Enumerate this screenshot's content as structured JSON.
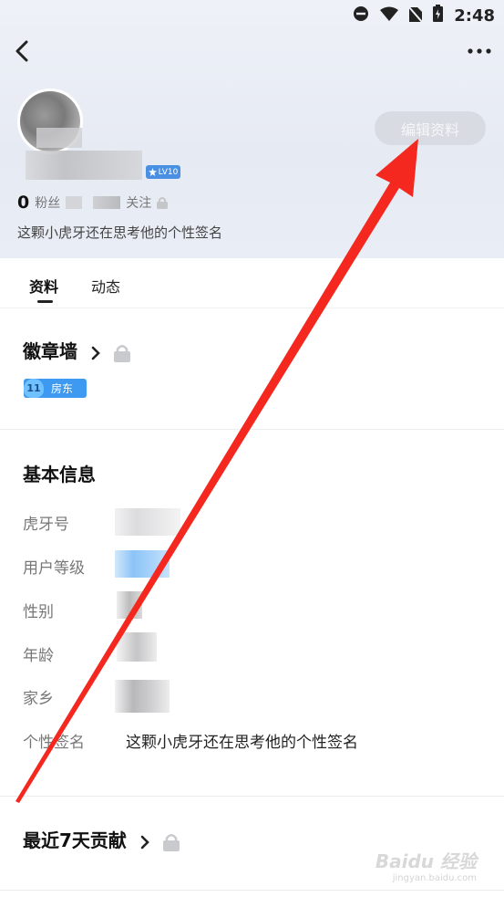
{
  "status_bar": {
    "time": "2:48"
  },
  "profile": {
    "level_badge": "LV10",
    "edit_button": "编辑资料",
    "fans_count": "0",
    "fans_label": "粉丝",
    "follow_label": "关注",
    "signature": "这颗小虎牙还在思考他的个性签名"
  },
  "tabs": [
    {
      "label": "资料"
    },
    {
      "label": "动态"
    }
  ],
  "badge_wall": {
    "title": "徽章墙",
    "badge_level": "11",
    "badge_name": "房东"
  },
  "basic_info": {
    "title": "基本信息",
    "rows": [
      {
        "label": "虎牙号"
      },
      {
        "label": "用户等级"
      },
      {
        "label": "性别"
      },
      {
        "label": "年龄"
      },
      {
        "label": "家乡"
      },
      {
        "label": "个性签名",
        "value": "这颗小虎牙还在思考他的个性签名"
      }
    ]
  },
  "contribution": {
    "title": "最近7天贡献"
  },
  "watermark": {
    "brand": "Baidu 经验",
    "url": "jingyan.baidu.com"
  },
  "colors": {
    "accent_blue": "#3d9af0",
    "annotation_red": "#f5281f"
  }
}
